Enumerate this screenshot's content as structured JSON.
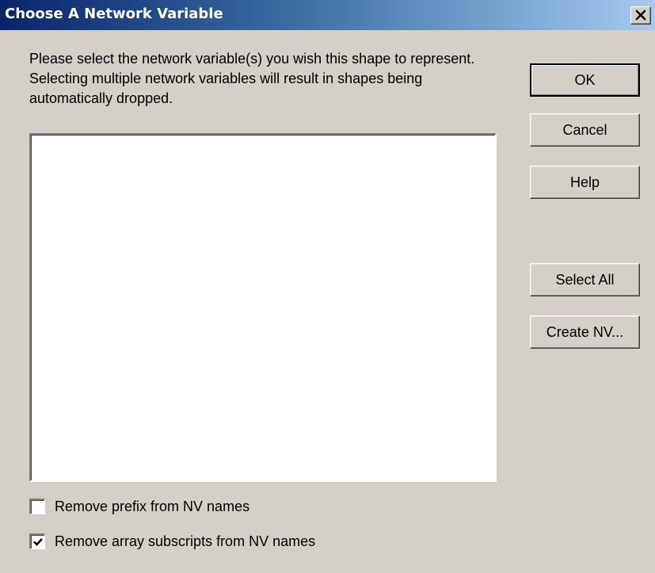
{
  "window": {
    "title": "Choose A Network Variable",
    "close_glyph": "✕"
  },
  "instructions": "Please select the network variable(s) you wish this shape to represent.  Selecting multiple network variables will result in shapes being automatically dropped.",
  "listbox": {
    "items": []
  },
  "buttons": {
    "ok": "OK",
    "cancel": "Cancel",
    "help": "Help",
    "select_all": "Select All",
    "create_nv": "Create NV..."
  },
  "options": {
    "remove_prefix": {
      "label": "Remove prefix from NV names",
      "checked": false
    },
    "remove_array_subscripts": {
      "label": "Remove array subscripts from NV names",
      "checked": true
    }
  },
  "colors": {
    "face": "#d4d0c8",
    "title_start": "#0a246a",
    "title_end": "#a6caf0"
  }
}
